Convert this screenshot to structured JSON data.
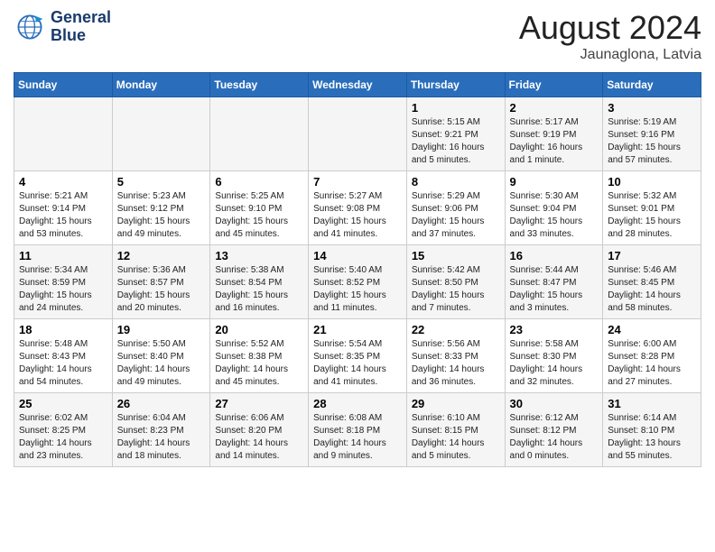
{
  "header": {
    "logo_line1": "General",
    "logo_line2": "Blue",
    "month": "August 2024",
    "location": "Jaunaglona, Latvia"
  },
  "weekdays": [
    "Sunday",
    "Monday",
    "Tuesday",
    "Wednesday",
    "Thursday",
    "Friday",
    "Saturday"
  ],
  "weeks": [
    [
      {
        "day": "",
        "info": ""
      },
      {
        "day": "",
        "info": ""
      },
      {
        "day": "",
        "info": ""
      },
      {
        "day": "",
        "info": ""
      },
      {
        "day": "1",
        "info": "Sunrise: 5:15 AM\nSunset: 9:21 PM\nDaylight: 16 hours\nand 5 minutes."
      },
      {
        "day": "2",
        "info": "Sunrise: 5:17 AM\nSunset: 9:19 PM\nDaylight: 16 hours\nand 1 minute."
      },
      {
        "day": "3",
        "info": "Sunrise: 5:19 AM\nSunset: 9:16 PM\nDaylight: 15 hours\nand 57 minutes."
      }
    ],
    [
      {
        "day": "4",
        "info": "Sunrise: 5:21 AM\nSunset: 9:14 PM\nDaylight: 15 hours\nand 53 minutes."
      },
      {
        "day": "5",
        "info": "Sunrise: 5:23 AM\nSunset: 9:12 PM\nDaylight: 15 hours\nand 49 minutes."
      },
      {
        "day": "6",
        "info": "Sunrise: 5:25 AM\nSunset: 9:10 PM\nDaylight: 15 hours\nand 45 minutes."
      },
      {
        "day": "7",
        "info": "Sunrise: 5:27 AM\nSunset: 9:08 PM\nDaylight: 15 hours\nand 41 minutes."
      },
      {
        "day": "8",
        "info": "Sunrise: 5:29 AM\nSunset: 9:06 PM\nDaylight: 15 hours\nand 37 minutes."
      },
      {
        "day": "9",
        "info": "Sunrise: 5:30 AM\nSunset: 9:04 PM\nDaylight: 15 hours\nand 33 minutes."
      },
      {
        "day": "10",
        "info": "Sunrise: 5:32 AM\nSunset: 9:01 PM\nDaylight: 15 hours\nand 28 minutes."
      }
    ],
    [
      {
        "day": "11",
        "info": "Sunrise: 5:34 AM\nSunset: 8:59 PM\nDaylight: 15 hours\nand 24 minutes."
      },
      {
        "day": "12",
        "info": "Sunrise: 5:36 AM\nSunset: 8:57 PM\nDaylight: 15 hours\nand 20 minutes."
      },
      {
        "day": "13",
        "info": "Sunrise: 5:38 AM\nSunset: 8:54 PM\nDaylight: 15 hours\nand 16 minutes."
      },
      {
        "day": "14",
        "info": "Sunrise: 5:40 AM\nSunset: 8:52 PM\nDaylight: 15 hours\nand 11 minutes."
      },
      {
        "day": "15",
        "info": "Sunrise: 5:42 AM\nSunset: 8:50 PM\nDaylight: 15 hours\nand 7 minutes."
      },
      {
        "day": "16",
        "info": "Sunrise: 5:44 AM\nSunset: 8:47 PM\nDaylight: 15 hours\nand 3 minutes."
      },
      {
        "day": "17",
        "info": "Sunrise: 5:46 AM\nSunset: 8:45 PM\nDaylight: 14 hours\nand 58 minutes."
      }
    ],
    [
      {
        "day": "18",
        "info": "Sunrise: 5:48 AM\nSunset: 8:43 PM\nDaylight: 14 hours\nand 54 minutes."
      },
      {
        "day": "19",
        "info": "Sunrise: 5:50 AM\nSunset: 8:40 PM\nDaylight: 14 hours\nand 49 minutes."
      },
      {
        "day": "20",
        "info": "Sunrise: 5:52 AM\nSunset: 8:38 PM\nDaylight: 14 hours\nand 45 minutes."
      },
      {
        "day": "21",
        "info": "Sunrise: 5:54 AM\nSunset: 8:35 PM\nDaylight: 14 hours\nand 41 minutes."
      },
      {
        "day": "22",
        "info": "Sunrise: 5:56 AM\nSunset: 8:33 PM\nDaylight: 14 hours\nand 36 minutes."
      },
      {
        "day": "23",
        "info": "Sunrise: 5:58 AM\nSunset: 8:30 PM\nDaylight: 14 hours\nand 32 minutes."
      },
      {
        "day": "24",
        "info": "Sunrise: 6:00 AM\nSunset: 8:28 PM\nDaylight: 14 hours\nand 27 minutes."
      }
    ],
    [
      {
        "day": "25",
        "info": "Sunrise: 6:02 AM\nSunset: 8:25 PM\nDaylight: 14 hours\nand 23 minutes."
      },
      {
        "day": "26",
        "info": "Sunrise: 6:04 AM\nSunset: 8:23 PM\nDaylight: 14 hours\nand 18 minutes."
      },
      {
        "day": "27",
        "info": "Sunrise: 6:06 AM\nSunset: 8:20 PM\nDaylight: 14 hours\nand 14 minutes."
      },
      {
        "day": "28",
        "info": "Sunrise: 6:08 AM\nSunset: 8:18 PM\nDaylight: 14 hours\nand 9 minutes."
      },
      {
        "day": "29",
        "info": "Sunrise: 6:10 AM\nSunset: 8:15 PM\nDaylight: 14 hours\nand 5 minutes."
      },
      {
        "day": "30",
        "info": "Sunrise: 6:12 AM\nSunset: 8:12 PM\nDaylight: 14 hours\nand 0 minutes."
      },
      {
        "day": "31",
        "info": "Sunrise: 6:14 AM\nSunset: 8:10 PM\nDaylight: 13 hours\nand 55 minutes."
      }
    ]
  ]
}
